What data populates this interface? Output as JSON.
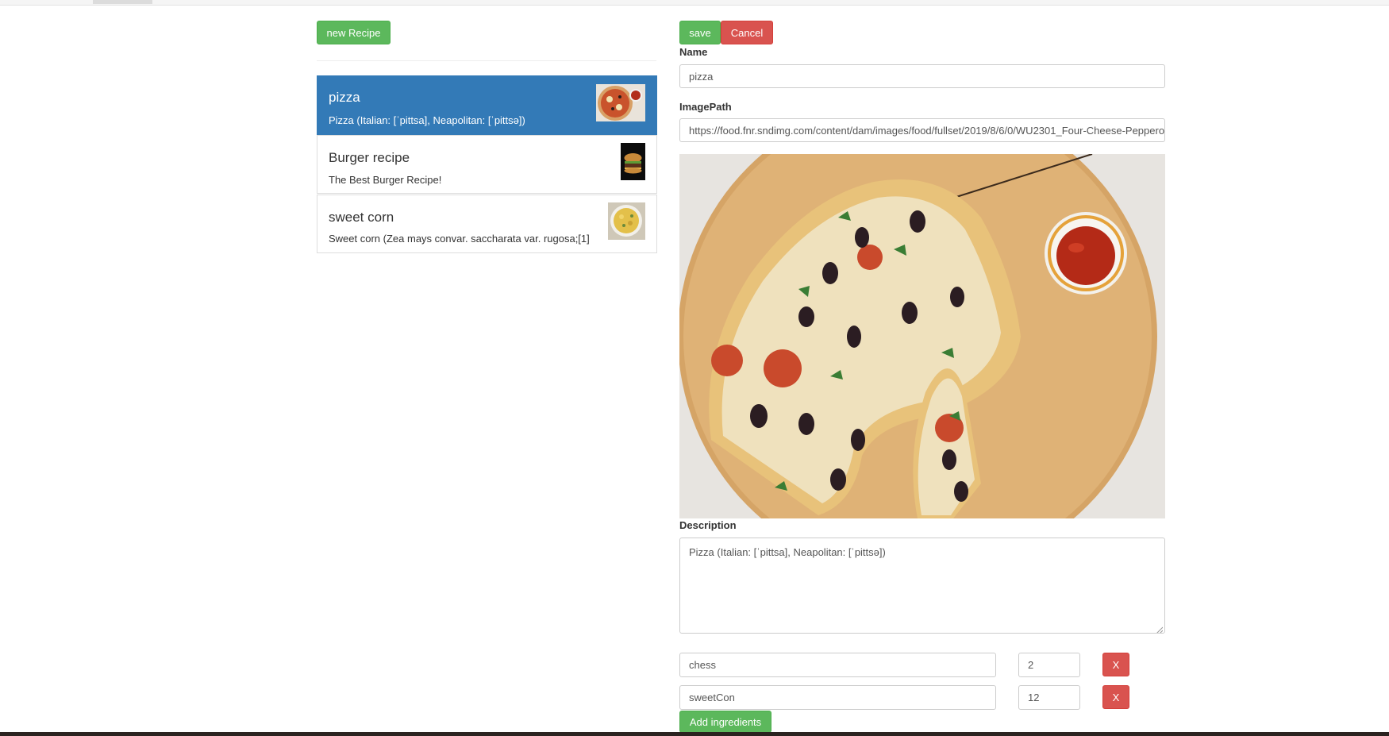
{
  "toolbar": {
    "new_recipe_label": "new Recipe"
  },
  "recipes": [
    {
      "name": "pizza",
      "description": "Pizza (Italian: [ˈpittsa], Neapolitan: [ˈpittsə])"
    },
    {
      "name": "Burger recipe",
      "description": "The Best Burger Recipe!"
    },
    {
      "name": "sweet corn",
      "description": "Sweet corn (Zea mays convar. saccharata var. rugosa;[1]"
    }
  ],
  "editor": {
    "save_label": "save",
    "cancel_label": "Cancel",
    "name_label": "Name",
    "name_value": "pizza",
    "imagepath_label": "ImagePath",
    "imagepath_value": "https://food.fnr.sndimg.com/content/dam/images/food/fullset/2019/8/6/0/WU2301_Four-Cheese-Pepperoni-Pizzadilla_s4x3.jpg",
    "description_label": "Description",
    "description_value": "Pizza (Italian: [ˈpittsa], Neapolitan: [ˈpittsə])",
    "ingredients": [
      {
        "name": "chess",
        "amount": "2",
        "remove_label": "X"
      },
      {
        "name": "sweetCon",
        "amount": "12",
        "remove_label": "X"
      }
    ],
    "add_ingredients_label": "Add ingredients"
  },
  "colors": {
    "success": "#5cb85c",
    "danger": "#d9534f",
    "active": "#337ab7"
  }
}
